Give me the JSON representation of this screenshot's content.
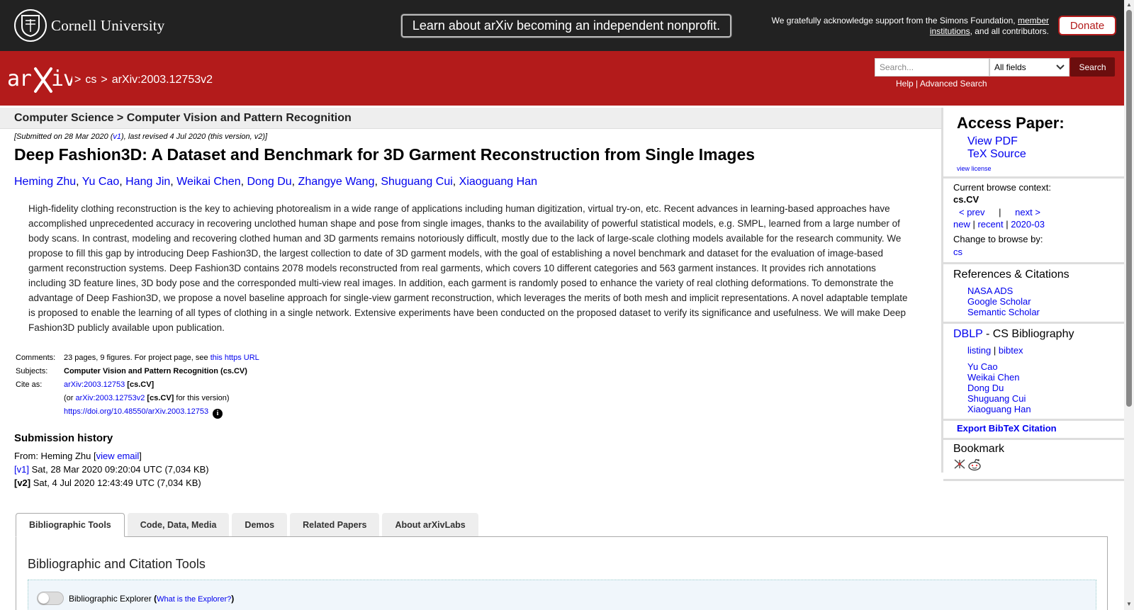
{
  "top_bar": {
    "institution": "Cornell University",
    "banner_button": "Learn about arXiv becoming an independent nonprofit.",
    "support_prefix": "We gratefully acknowledge support from the Simons Foundation,",
    "support_link": "member institutions",
    "support_suffix": ", and all contributors.",
    "donate": "Donate"
  },
  "header": {
    "logo": "arXiv",
    "breadcrumb": [
      ">",
      "cs",
      ">",
      "arXiv:2003.12753v2"
    ],
    "search_placeholder": "Search...",
    "search_field": "All fields",
    "search_button": "Search",
    "help": "Help",
    "advanced_search": "Advanced Search"
  },
  "subject_bar": "Computer Science > Computer Vision and Pattern Recognition",
  "paper": {
    "dateline_prefix": "[Submitted on 28 Mar 2020 (",
    "dateline_v1": "v1",
    "dateline_suffix": "), last revised 4 Jul 2020 (this version, v2)]",
    "title": "Deep Fashion3D: A Dataset and Benchmark for 3D Garment Reconstruction from Single Images",
    "authors": [
      "Heming Zhu",
      "Yu Cao",
      "Hang Jin",
      "Weikai Chen",
      "Dong Du",
      "Zhangye Wang",
      "Shuguang Cui",
      "Xiaoguang Han"
    ],
    "abstract": "High-fidelity clothing reconstruction is the key to achieving photorealism in a wide range of applications including human digitization, virtual try-on, etc. Recent advances in learning-based approaches have accomplished unprecedented accuracy in recovering unclothed human shape and pose from single images, thanks to the availability of powerful statistical models, e.g. SMPL, learned from a large number of body scans. In contrast, modeling and recovering clothed human and 3D garments remains notoriously difficult, mostly due to the lack of large-scale clothing models available for the research community. We propose to fill this gap by introducing Deep Fashion3D, the largest collection to date of 3D garment models, with the goal of establishing a novel benchmark and dataset for the evaluation of image-based garment reconstruction systems. Deep Fashion3D contains 2078 models reconstructed from real garments, which covers 10 different categories and 563 garment instances. It provides rich annotations including 3D feature lines, 3D body pose and the corresponded multi-view real images. In addition, each garment is randomly posed to enhance the variety of real clothing deformations. To demonstrate the advantage of Deep Fashion3D, we propose a novel baseline approach for single-view garment reconstruction, which leverages the merits of both mesh and implicit representations. A novel adaptable template is proposed to enable the learning of all types of clothing in a single network. Extensive experiments have been conducted on the proposed dataset to verify its significance and usefulness. We will make Deep Fashion3D publicly available upon publication.",
    "comments_label": "Comments:",
    "comments_text": "23 pages, 9 figures. For project page, see ",
    "comments_link": "this https URL",
    "subjects_label": "Subjects:",
    "subjects": "Computer Vision and Pattern Recognition (cs.CV)",
    "cite_label": "Cite as:",
    "cite_id": "arXiv:2003.12753",
    "cite_cat": "[cs.CV]",
    "cite_or_prefix": "(or ",
    "cite_version_id": "arXiv:2003.12753v2",
    "cite_version_suffix": " for this version)",
    "doi": "https://doi.org/10.48550/arXiv.2003.12753"
  },
  "history": {
    "heading": "Submission history",
    "from_prefix": "From: Heming Zhu [",
    "view_email": "view email",
    "from_suffix": "]",
    "v1_label": "[v1]",
    "v1_text": " Sat, 28 Mar 2020 09:20:04 UTC (7,034 KB)",
    "v2_label": "[v2]",
    "v2_text": " Sat, 4 Jul 2020 12:43:49 UTC (7,034 KB)"
  },
  "tabs": [
    "Bibliographic Tools",
    "Code, Data, Media",
    "Demos",
    "Related Papers",
    "About arXivLabs"
  ],
  "tab_panel": {
    "heading": "Bibliographic and Citation Tools",
    "explorer_label": "Bibliographic Explorer",
    "explorer_link": "What is the Explorer?"
  },
  "sidebar": {
    "access_heading": "Access Paper:",
    "view_pdf": "View PDF",
    "tex_source": "TeX Source",
    "view_license": "view license",
    "browse_context_label": "Current browse context:",
    "browse_context": "cs.CV",
    "prev": "< prev",
    "separator": "|",
    "next": "next >",
    "new": "new",
    "recent": "recent",
    "date": "2020-03",
    "change_browse": "Change to browse by:",
    "browse_cs": "cs",
    "refs_heading": "References & Citations",
    "refs": [
      "NASA ADS",
      "Google Scholar",
      "Semantic Scholar"
    ],
    "dblp": "DBLP",
    "dblp_suffix": " - CS Bibliography",
    "listing": "listing",
    "bibtex": "bibtex",
    "dblp_authors": [
      "Yu Cao",
      "Weikai Chen",
      "Dong Du",
      "Shuguang Cui",
      "Xiaoguang Han"
    ],
    "export_bibtex": "Export BibTeX Citation",
    "bookmark_heading": "Bookmark"
  }
}
